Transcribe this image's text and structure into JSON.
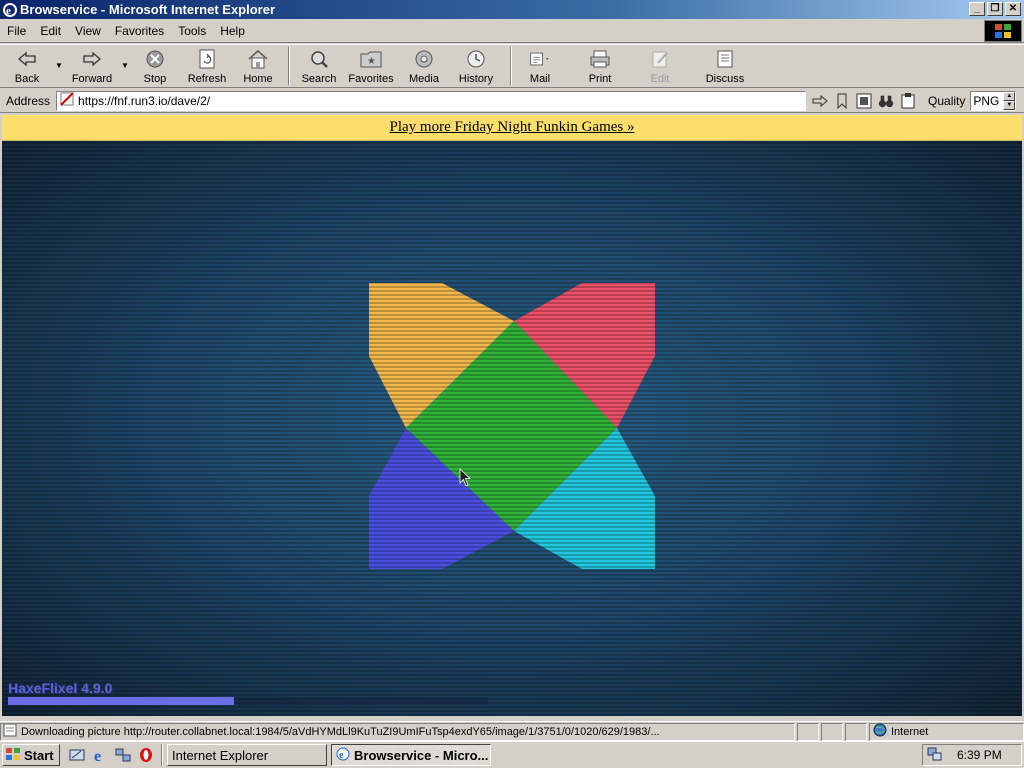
{
  "window": {
    "title": "Browservice - Microsoft Internet Explorer",
    "controls": [
      "minimize",
      "restore",
      "close"
    ]
  },
  "menu": {
    "items": [
      "File",
      "Edit",
      "View",
      "Favorites",
      "Tools",
      "Help"
    ]
  },
  "toolbar": {
    "back": "Back",
    "forward": "Forward",
    "stop": "Stop",
    "refresh": "Refresh",
    "home": "Home",
    "search": "Search",
    "favorites": "Favorites",
    "media": "Media",
    "history": "History",
    "mail": "Mail",
    "print": "Print",
    "edit": "Edit",
    "discuss": "Discuss"
  },
  "address": {
    "label": "Address",
    "url": "https://fnf.run3.io/dave/2/",
    "quality_label": "Quality",
    "quality_value": "PNG"
  },
  "banner": {
    "link_text": "Play more Friday Night Funkin Games »"
  },
  "game": {
    "engine_label": "HaxeFlixel 4.9.0",
    "loading_progress": 0.47,
    "logo_colors": {
      "yellow": "#f2b84b",
      "red": "#ee5068",
      "green": "#2fb23a",
      "blue": "#4b50e0",
      "cyan": "#22c6df"
    }
  },
  "status": {
    "text": "Downloading picture http://router.collabnet.local:1984/5/aVdHYMdLl9KuTuZI9UmIFuTsp4exdY65/image/1/3751/0/1020/629/1983/...",
    "zone": "Internet"
  },
  "taskbar": {
    "start": "Start",
    "tasks": [
      "Internet Explorer",
      "Browservice - Micro..."
    ],
    "clock": "6:39 PM"
  }
}
